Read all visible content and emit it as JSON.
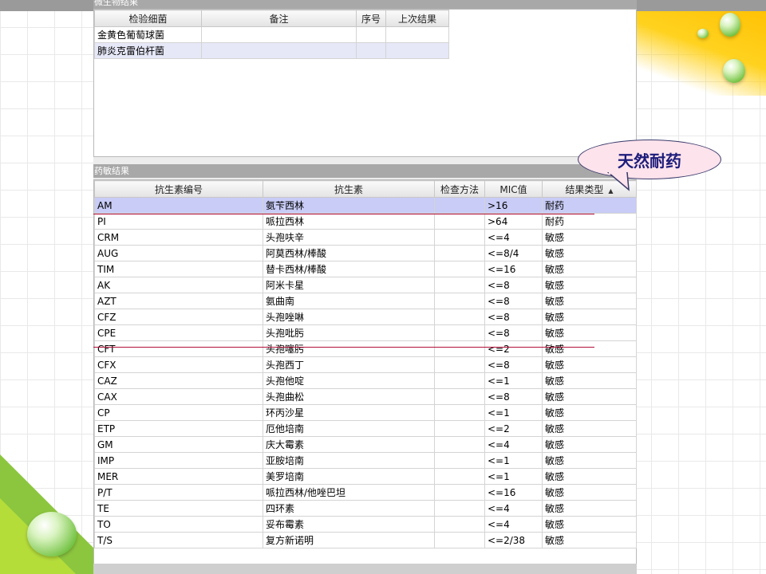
{
  "micro": {
    "title": "微生物结果",
    "columns": [
      "检验细菌",
      "备注",
      "序号",
      "上次结果"
    ],
    "rows": [
      [
        "金黄色葡萄球菌",
        "",
        "",
        ""
      ],
      [
        "肺炎克雷伯杆菌",
        "",
        "",
        ""
      ]
    ]
  },
  "sens": {
    "title": "药敏结果",
    "columns": [
      "抗生素编号",
      "抗生素",
      "检查方法",
      "MIC值",
      "结果类型"
    ],
    "rows": [
      [
        "AM",
        "氨苄西林",
        "",
        ">16",
        "耐药"
      ],
      [
        "PI",
        "哌拉西林",
        "",
        ">64",
        "耐药"
      ],
      [
        "CRM",
        "头孢呋辛",
        "",
        "<=4",
        "敏感"
      ],
      [
        "AUG",
        "阿莫西林/棒酸",
        "",
        "<=8/4",
        "敏感"
      ],
      [
        "TIM",
        "替卡西林/棒酸",
        "",
        "<=16",
        "敏感"
      ],
      [
        "AK",
        "阿米卡星",
        "",
        "<=8",
        "敏感"
      ],
      [
        "AZT",
        "氨曲南",
        "",
        "<=8",
        "敏感"
      ],
      [
        "CFZ",
        "头孢唑啉",
        "",
        "<=8",
        "敏感"
      ],
      [
        "CPE",
        "头孢吡肟",
        "",
        "<=8",
        "敏感"
      ],
      [
        "CFT",
        "头孢噻肟",
        "",
        "<=2",
        "敏感"
      ],
      [
        "CFX",
        "头孢西丁",
        "",
        "<=8",
        "敏感"
      ],
      [
        "CAZ",
        "头孢他啶",
        "",
        "<=1",
        "敏感"
      ],
      [
        "CAX",
        "头孢曲松",
        "",
        "<=8",
        "敏感"
      ],
      [
        "CP",
        "环丙沙星",
        "",
        "<=1",
        "敏感"
      ],
      [
        "ETP",
        "厄他培南",
        "",
        "<=2",
        "敏感"
      ],
      [
        "GM",
        "庆大霉素",
        "",
        "<=4",
        "敏感"
      ],
      [
        "IMP",
        "亚胺培南",
        "",
        "<=1",
        "敏感"
      ],
      [
        "MER",
        "美罗培南",
        "",
        "<=1",
        "敏感"
      ],
      [
        "P/T",
        "哌拉西林/他唑巴坦",
        "",
        "<=16",
        "敏感"
      ],
      [
        "TE",
        "四环素",
        "",
        "<=4",
        "敏感"
      ],
      [
        "TO",
        "妥布霉素",
        "",
        "<=4",
        "敏感"
      ],
      [
        "T/S",
        "复方新诺明",
        "",
        "<=2/38",
        "敏感"
      ]
    ]
  },
  "callout": {
    "text": "天然耐药"
  },
  "colors": {
    "selected_row": "#c8ccf6",
    "annotation_line": "#b0103a",
    "callout_fill": "#fde3ec"
  }
}
